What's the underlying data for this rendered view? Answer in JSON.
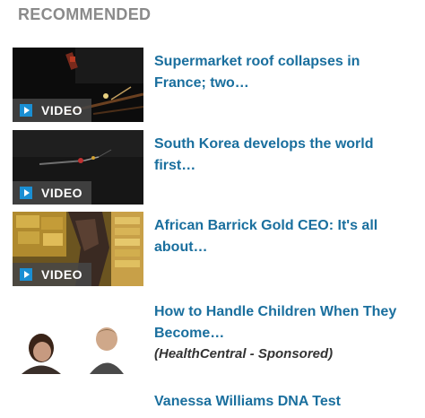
{
  "heading": "RECOMMENDED",
  "video_label": "VIDEO",
  "items": [
    {
      "title": "Supermarket roof collapses in France; two…"
    },
    {
      "title": "South Korea develops the world first…"
    },
    {
      "title": "African Barrick Gold CEO: It's all about…"
    },
    {
      "title": "How to Handle Children When They Become…",
      "sponsor": "(HealthCentral - Sponsored)"
    },
    {
      "title": "Vanessa Williams DNA Test"
    }
  ],
  "colors": {
    "link": "#1a6f9e",
    "heading": "#8a8a8a",
    "play_accent": "#1a8fd3"
  },
  "icons": {
    "play": "play-icon"
  }
}
